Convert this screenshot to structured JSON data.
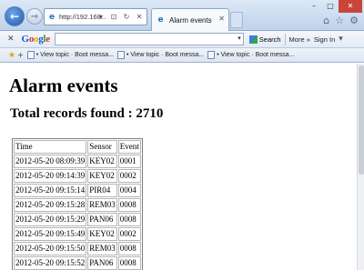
{
  "browser": {
    "address_url": "http://192.168....",
    "tab_title": "Alarm events",
    "nav": {
      "back_glyph": "←",
      "forward_glyph": "→"
    },
    "address_tools": {
      "search_glyph": "▾",
      "compat_glyph": "⊡",
      "refresh_glyph": "↻",
      "stop_glyph": "✕"
    },
    "tab_close_glyph": "✕",
    "window": {
      "minimize": "–",
      "maximize": "□",
      "close": "✕"
    },
    "right_icons": {
      "home": "⌂",
      "favorites": "☆",
      "tools": "⚙"
    }
  },
  "google_toolbar": {
    "close_glyph": "✕",
    "logo": {
      "G": "G",
      "o1": "o",
      "o2": "o",
      "g": "g",
      "l": "l",
      "e": "e"
    },
    "search_label": "Search",
    "search_dropdown": "▾",
    "more_label": "More »",
    "signin_label": "Sign In",
    "wrench_glyph": "▾"
  },
  "favorites_bar": {
    "star_glyph": "★",
    "add_glyph": "+",
    "items": [
      {
        "label": "• View topic · Boot messa..."
      },
      {
        "label": "• View topic · Boot messa..."
      },
      {
        "label": "• View topic · Boot messa..."
      }
    ]
  },
  "page": {
    "title": "Alarm events",
    "records_summary": "Total records found : 2710",
    "table": {
      "headers": [
        "Time",
        "Sensor",
        "Event"
      ],
      "rows": [
        [
          "2012-05-20 08:09:39",
          "KEY02",
          "0001"
        ],
        [
          "2012-05-20 09:14:39",
          "KEY02",
          "0002"
        ],
        [
          "2012-05-20 09:15:14",
          "PIR04",
          "0004"
        ],
        [
          "2012-05-20 09:15:28",
          "REM03",
          "0008"
        ],
        [
          "2012-05-20 09:15:29",
          "PAN06",
          "0008"
        ],
        [
          "2012-05-20 09:15:49",
          "KEY02",
          "0002"
        ],
        [
          "2012-05-20 09:15:50",
          "REM03",
          "0008"
        ],
        [
          "2012-05-20 09:15:52",
          "PAN06",
          "0008"
        ]
      ]
    }
  },
  "colors": {
    "chrome_top": "#dce8f6",
    "chrome_bottom": "#bfd3ec",
    "back_button": "#1e5bb8",
    "close_button": "#c8453a"
  }
}
